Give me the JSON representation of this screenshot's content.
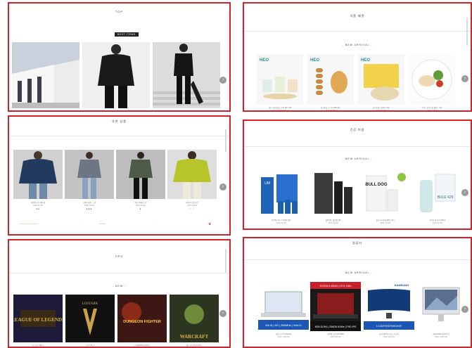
{
  "panels": {
    "top": {
      "title": "TOP",
      "badge": "BEST ITEMS",
      "products": [
        {
          "name": "",
          "price": ""
        },
        {
          "name": "",
          "price": ""
        },
        {
          "name": "",
          "price": ""
        }
      ]
    },
    "recommend": {
      "title": "추천 상품",
      "products": [
        {
          "name": "네이비 니트 맨투맨",
          "price": "KRW 38,000",
          "dots": "●●"
        },
        {
          "name": "그레이 라운드 니트",
          "price": "KRW 34,000",
          "dots": "●●●"
        },
        {
          "name": "카키 오버핏 니트",
          "price": "KRW 36,000",
          "dots": "●"
        },
        {
          "name": "라임 루즈핏 니트",
          "price": "KRW 39,000",
          "dots": "○ ○"
        }
      ],
      "strip": [
        "━━━━━━━━━━━━━━━━━━",
        "· · · · ·",
        "━━━━━━",
        "· · ·",
        "♛"
      ]
    },
    "fps": {
      "title": "FPS",
      "new_label": "- NEW -",
      "games": [
        {
          "label": "LEAGUE OF LEGENDS",
          "name": "리그 오브 레전드"
        },
        {
          "label": "LOSTARK",
          "name": "로스트아크"
        },
        {
          "label": "DUNGEON FIGHTER",
          "name": "던전앤파이터 온라인"
        },
        {
          "label": "WARCRAFT",
          "name": "월드 오브 워크래프트"
        }
      ]
    },
    "food": {
      "title": "식품 패럿",
      "new_label": "- NEW ARRIVAL -",
      "products": [
        {
          "brand": "HEO",
          "name": "헬스 닭가슴살 도시락 세트 3팩",
          "price": "KRW 12,900"
        },
        {
          "brand": "HEO",
          "name": "닭가슴살 소시지 10팩 세트",
          "price": "KRW 14,500"
        },
        {
          "brand": "HEO",
          "name": "닭가슴살 스테이크 1kg",
          "price": "KRW 15,900"
        },
        {
          "brand": "",
          "name": "수비드 닭가슴살 샐러드 세트",
          "price": "KRW 11,900"
        }
      ]
    },
    "cosmetic": {
      "title": "건강 미용",
      "new_label": "- NEW ARRIVAL -",
      "products": [
        {
          "brand": "UM",
          "name": "아쿠아 수분 스킨케어 세트",
          "price": "KRW 42,000"
        },
        {
          "brand": "",
          "name": "블랙 옴므 올인원 세트",
          "price": "KRW 38,000"
        },
        {
          "brand": "BULL DOG",
          "name": "불독 오리지널 페이스워시",
          "price": "KRW 12,000"
        },
        {
          "brand": "BULE 429",
          "name": "모이스처 로션 200ml",
          "price": "KRW 22,000"
        }
      ]
    },
    "electronics": {
      "title": "컴퓨터",
      "new_label": "- NEW ARRIVAL -",
      "products": [
        {
          "banner": "8th i5 | 8G | 256MHz | Win10",
          "top_label": "삼성 노트북 9 Always",
          "name": "삼성 노트북 9 Always",
          "price": "KRW 1,290,000"
        },
        {
          "banner": "8GB DDR4 | 256GB NVMe | FHD IPS",
          "top_label": "RYZEN 5 3500H | GTX 1650",
          "name": "게이밍 노트북 RYZEN",
          "price": "KRW 990,000"
        },
        {
          "banner": "LC32F391FWKXKR",
          "top_label": "SAMSUNG",
          "name": "삼성 32인치 커브드 모니터",
          "price": "KRW 299,000"
        },
        {
          "banner": "",
          "top_label": "",
          "name": "Apple iMac 21.5 인치",
          "price": "KRW 1,490,000"
        }
      ]
    }
  },
  "colors": {
    "panel_border": "#d5212a",
    "arrow": "#9a9a9a"
  }
}
